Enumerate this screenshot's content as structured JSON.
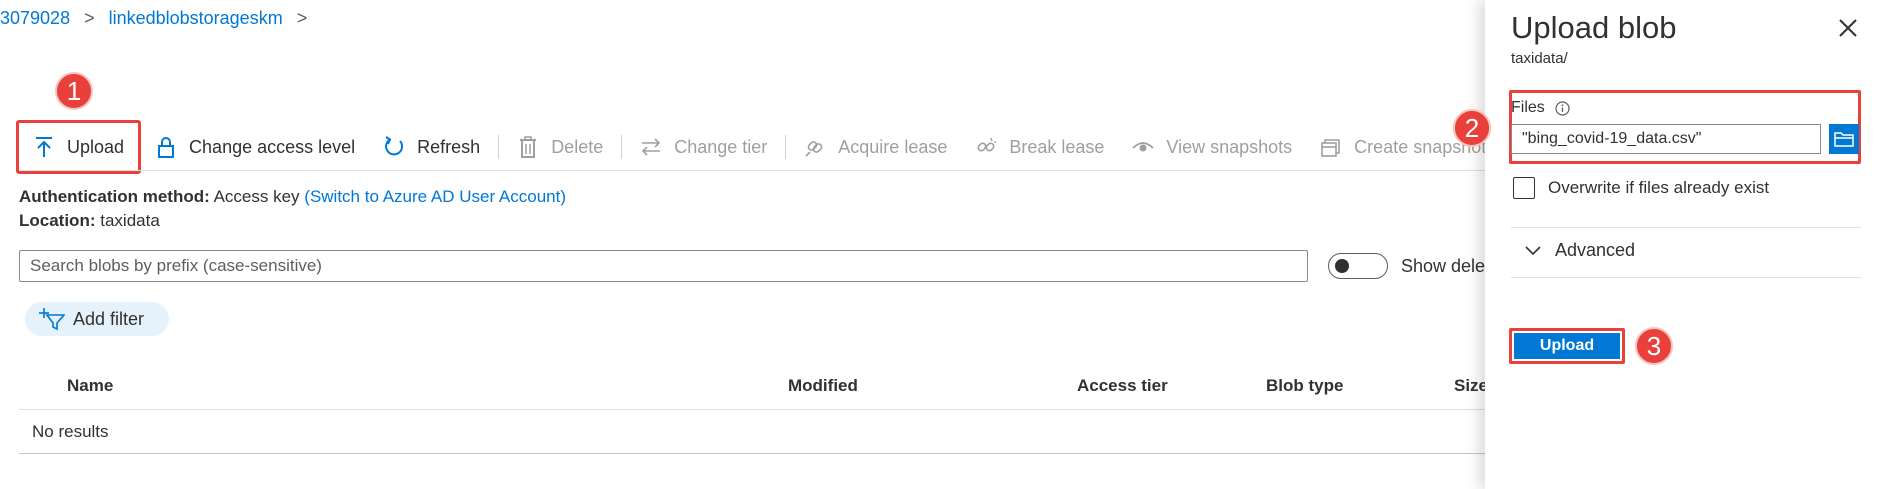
{
  "breadcrumb": {
    "items": [
      "3079028",
      "linkedblobstorageskm"
    ],
    "separator": ">"
  },
  "toolbar": {
    "upload_label": "Upload",
    "change_access_label": "Change access level",
    "refresh_label": "Refresh",
    "delete_label": "Delete",
    "change_tier_label": "Change tier",
    "acquire_lease_label": "Acquire lease",
    "break_lease_label": "Break lease",
    "view_snapshots_label": "View snapshots",
    "create_snapshot_label": "Create snapshot"
  },
  "info": {
    "auth_label": "Authentication method:",
    "auth_value": "Access key",
    "auth_link": "(Switch to Azure AD User Account)",
    "location_label": "Location:",
    "location_value": "taxidata"
  },
  "search": {
    "placeholder": "Search blobs by prefix (case-sensitive)"
  },
  "show_deleted_label": "Show delet",
  "filter": {
    "add_filter_label": "Add filter"
  },
  "table": {
    "columns": [
      "Name",
      "Modified",
      "Access tier",
      "Blob type",
      "Size"
    ],
    "empty_text": "No results"
  },
  "panel": {
    "title": "Upload blob",
    "subtitle": "taxidata/",
    "files_label": "Files",
    "files_value": "\"bing_covid-19_data.csv\"",
    "overwrite_label": "Overwrite if files already exist",
    "overwrite_checked": false,
    "advanced_label": "Advanced",
    "upload_button_label": "Upload"
  },
  "steps": {
    "step1": "1",
    "step2": "2",
    "step3": "3"
  },
  "colors": {
    "accent": "#0078d4",
    "highlight": "#e8413b"
  }
}
